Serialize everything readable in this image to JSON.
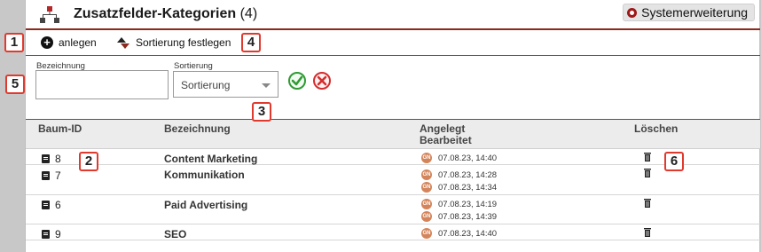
{
  "header": {
    "title": "Zusatzfelder-Kategorien",
    "count": "(4)",
    "system_button": "Systemerweiterung"
  },
  "toolbar": {
    "add_label": "anlegen",
    "sort_label": "Sortierung festlegen"
  },
  "form": {
    "name_label": "Bezeichnung",
    "name_value": "",
    "sort_label": "Sortierung",
    "sort_selected": "Sortierung"
  },
  "table": {
    "headers": {
      "id": "Baum-ID",
      "name": "Bezeichnung",
      "created": "Angelegt",
      "edited": "Bearbeitet",
      "delete": "Löschen"
    },
    "rows": [
      {
        "id": "8",
        "name": "Content Marketing",
        "dates": [
          "07.08.23, 14:40"
        ]
      },
      {
        "id": "7",
        "name": "Kommunikation",
        "dates": [
          "07.08.23, 14:28",
          "07.08.23, 14:34"
        ]
      },
      {
        "id": "6",
        "name": "Paid Advertising",
        "dates": [
          "07.08.23, 14:19",
          "07.08.23, 14:39"
        ]
      },
      {
        "id": "9",
        "name": "SEO",
        "dates": [
          "07.08.23, 14:40"
        ]
      }
    ],
    "user_initials": "GN"
  },
  "badges": [
    "1",
    "2",
    "3",
    "4",
    "5",
    "6"
  ]
}
